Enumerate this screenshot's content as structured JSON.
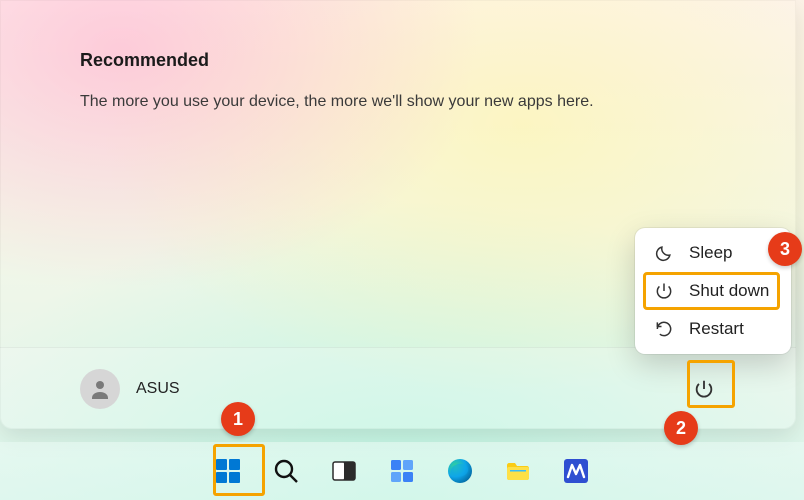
{
  "startMenu": {
    "recommendedTitle": "Recommended",
    "recommendedBody": "The more you use your device, the more we'll show your new apps here.",
    "user": {
      "name": "ASUS"
    }
  },
  "powerMenu": {
    "items": [
      {
        "label": "Sleep",
        "icon": "moon-icon"
      },
      {
        "label": "Shut down",
        "icon": "power-icon"
      },
      {
        "label": "Restart",
        "icon": "restart-icon"
      }
    ]
  },
  "callouts": {
    "one": "1",
    "two": "2",
    "three": "3"
  },
  "taskbar": {
    "buttons": [
      {
        "name": "start-button",
        "icon": "windows-icon"
      },
      {
        "name": "search-button",
        "icon": "search-icon"
      },
      {
        "name": "taskview-button",
        "icon": "taskview-icon"
      },
      {
        "name": "widgets-button",
        "icon": "widgets-icon"
      },
      {
        "name": "edge-button",
        "icon": "edge-icon"
      },
      {
        "name": "explorer-button",
        "icon": "folder-icon"
      },
      {
        "name": "myasus-button",
        "icon": "myasus-icon"
      }
    ]
  }
}
